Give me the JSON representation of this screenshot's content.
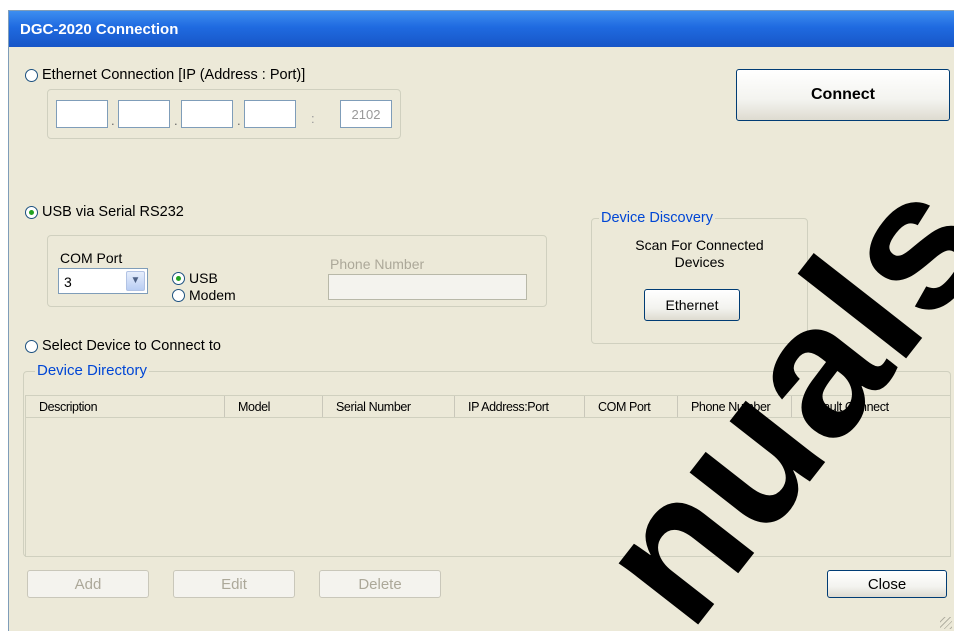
{
  "window": {
    "title": "DGC-2020 Connection"
  },
  "ethernet": {
    "radio_label": "Ethernet Connection [IP (Address : Port)]",
    "selected": false,
    "ip_octets": [
      "",
      "",
      "",
      ""
    ],
    "port_separator": ":",
    "port": "2102"
  },
  "connect_label": "Connect",
  "usb": {
    "radio_label": "USB via Serial RS232",
    "selected": true,
    "com_port_label": "COM Port",
    "com_port_value": "3",
    "usb_label": "USB",
    "usb_selected": true,
    "modem_label": "Modem",
    "modem_selected": false,
    "phone_label": "Phone Number",
    "phone_value": ""
  },
  "discovery": {
    "title": "Device Discovery",
    "text_line1": "Scan For Connected",
    "text_line2": "Devices",
    "ethernet_button": "Ethernet"
  },
  "select_device": {
    "radio_label": "Select Device to Connect to",
    "selected": false
  },
  "directory": {
    "title": "Device Directory",
    "columns": [
      "Description",
      "Model",
      "Serial Number",
      "IP Address:Port",
      "COM Port",
      "Phone Number",
      "Default Connect"
    ],
    "rows": []
  },
  "buttons": {
    "add": "Add",
    "edit": "Edit",
    "delete": "Delete",
    "close": "Close"
  },
  "watermark": {
    "text": "nuals"
  },
  "colors": {
    "titlebar": "#1f6ae0",
    "accent_text": "#0046d5",
    "dialog_bg": "#ece9d8",
    "watermark": "#000000"
  }
}
